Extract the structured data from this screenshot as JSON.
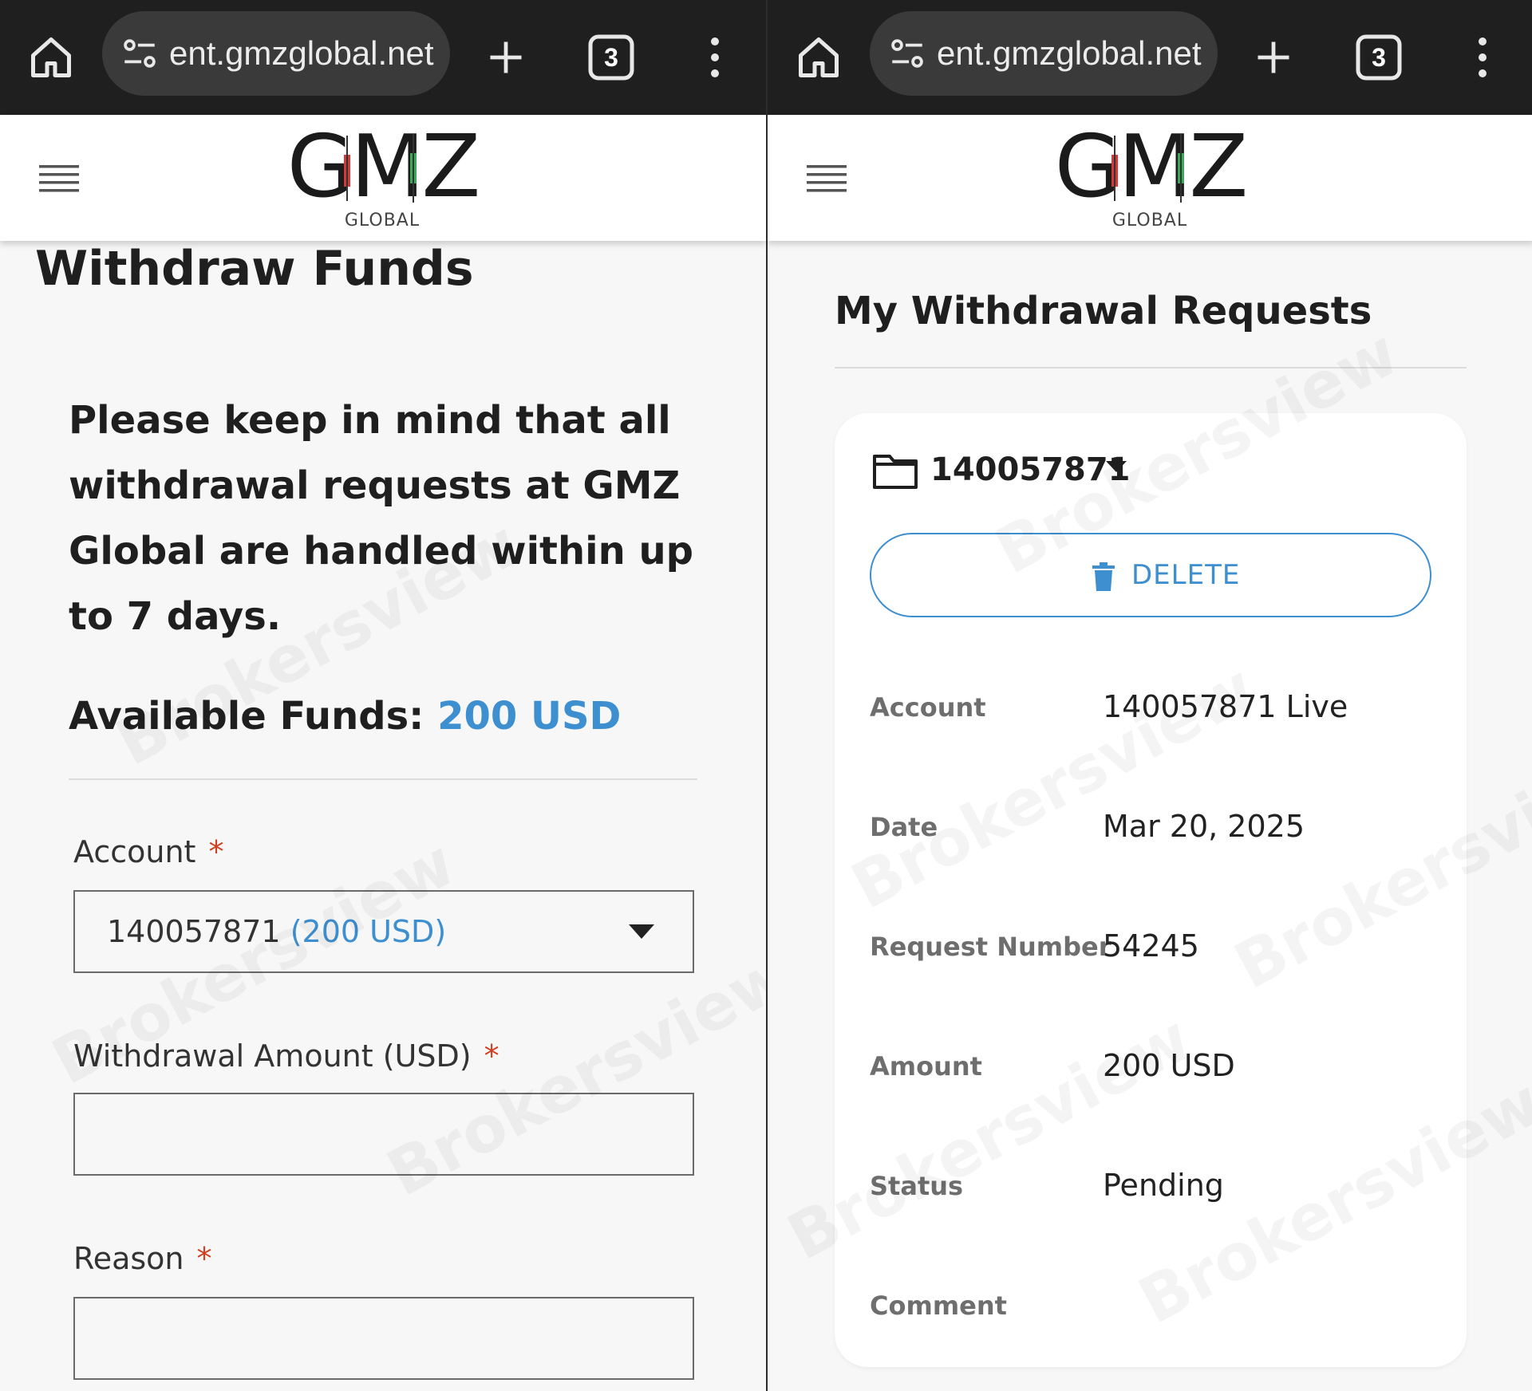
{
  "browser": {
    "url": "ent.gmzglobal.net",
    "tab_count": "3"
  },
  "logo": {
    "main": "GMZ",
    "sub": "GLOBAL"
  },
  "withdraw": {
    "title": "Withdraw Funds",
    "notice": "Please keep in mind that all withdrawal requests at GMZ Global are handled within up to 7 days.",
    "available_label": "Available Funds:",
    "available_value": "200 USD",
    "account_label": "Account",
    "account_value": "140057871",
    "account_balance": "(200 USD)",
    "amount_label": "Withdrawal Amount (USD)",
    "amount_value": "",
    "reason_label": "Reason",
    "reason_value": "",
    "required_mark": "*"
  },
  "requests": {
    "title": "My Withdrawal Requests",
    "selected_account": "140057871",
    "delete_label": "DELETE",
    "rows": [
      {
        "label": "Account",
        "value": "140057871 Live"
      },
      {
        "label": "Date",
        "value": "Mar 20, 2025"
      },
      {
        "label": "Request Number",
        "value": "54245"
      },
      {
        "label": "Amount",
        "value": "200 USD"
      },
      {
        "label": "Status",
        "value": "Pending"
      },
      {
        "label": "Comment",
        "value": ""
      }
    ]
  },
  "watermark": "Brokersview",
  "colors": {
    "accent": "#3d8fd0",
    "required": "#d04020",
    "chrome": "#1f1f1f"
  }
}
